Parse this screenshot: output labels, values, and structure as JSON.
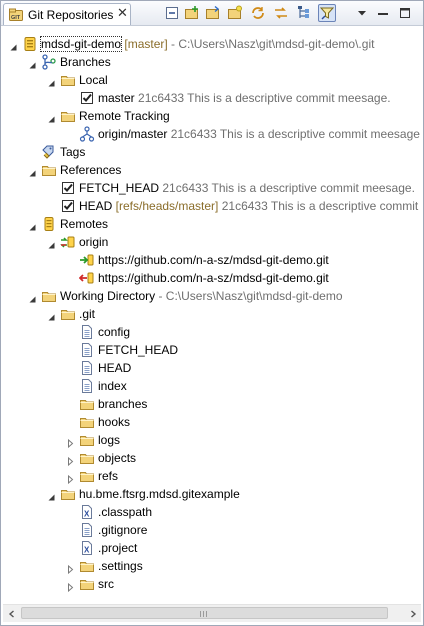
{
  "view": {
    "tab_title": "Git Repositories",
    "tab_icon": "git-repositories-icon",
    "close_glyph": "✕"
  },
  "toolbar": [
    {
      "name": "collapse-all-button",
      "icon": "collapse-all-icon"
    },
    {
      "name": "add-existing-repository-button",
      "icon": "add-repository-icon"
    },
    {
      "name": "clone-repository-button",
      "icon": "clone-repository-icon"
    },
    {
      "name": "create-repository-button",
      "icon": "create-repository-icon"
    },
    {
      "name": "refresh-button",
      "icon": "refresh-icon"
    },
    {
      "name": "link-with-selection-button",
      "icon": "link-with-selection-icon"
    },
    {
      "name": "hierarchical-branch-layout-button",
      "icon": "hierarchy-icon"
    },
    {
      "name": "show-tags-button",
      "icon": "filter-tags-icon",
      "active": true
    },
    {
      "name": "view-menu-button",
      "icon": "view-menu-triangle-icon"
    },
    {
      "name": "minimize-button",
      "icon": "minimize-icon"
    },
    {
      "name": "maximize-button",
      "icon": "maximize-icon"
    }
  ],
  "tree": [
    {
      "level": 0,
      "twisty": "expanded",
      "icon": "git-repository-icon",
      "parts": [
        {
          "t": "mdsd-git-demo",
          "c": "main"
        },
        {
          "t": " [master]",
          "c": "dec"
        },
        {
          "t": " - C:\\Users\\Nasz\\git\\mdsd-git-demo\\.git",
          "c": "grey"
        }
      ],
      "selected": true
    },
    {
      "level": 1,
      "twisty": "expanded",
      "icon": "branches-icon",
      "parts": [
        {
          "t": "Branches",
          "c": "main"
        }
      ]
    },
    {
      "level": 2,
      "twisty": "expanded",
      "icon": "folder-icon",
      "parts": [
        {
          "t": "Local",
          "c": "main"
        }
      ]
    },
    {
      "level": 3,
      "twisty": "none",
      "icon": "checked-out-branch-icon",
      "parts": [
        {
          "t": "master",
          "c": "main"
        },
        {
          "t": " 21c6433 This is a descriptive commit meesage.",
          "c": "grey"
        }
      ]
    },
    {
      "level": 2,
      "twisty": "expanded",
      "icon": "folder-icon",
      "parts": [
        {
          "t": "Remote Tracking",
          "c": "main"
        }
      ]
    },
    {
      "level": 3,
      "twisty": "none",
      "icon": "remote-branch-icon",
      "parts": [
        {
          "t": "origin/master",
          "c": "main"
        },
        {
          "t": " 21c6433 This is a descriptive commit meesage",
          "c": "grey"
        }
      ]
    },
    {
      "level": 1,
      "twisty": "none",
      "icon": "tags-icon",
      "parts": [
        {
          "t": "Tags",
          "c": "main"
        }
      ]
    },
    {
      "level": 1,
      "twisty": "expanded",
      "icon": "folder-icon",
      "parts": [
        {
          "t": "References",
          "c": "main"
        }
      ]
    },
    {
      "level": 2,
      "twisty": "none",
      "icon": "reference-icon",
      "parts": [
        {
          "t": "FETCH_HEAD",
          "c": "main"
        },
        {
          "t": " 21c6433 This is a descriptive commit meesage.",
          "c": "grey"
        }
      ]
    },
    {
      "level": 2,
      "twisty": "none",
      "icon": "reference-icon",
      "parts": [
        {
          "t": "HEAD",
          "c": "main"
        },
        {
          "t": " [refs/heads/master]",
          "c": "dec"
        },
        {
          "t": " 21c6433 This is a descriptive commit",
          "c": "grey"
        }
      ]
    },
    {
      "level": 1,
      "twisty": "expanded",
      "icon": "remotes-icon",
      "parts": [
        {
          "t": "Remotes",
          "c": "main"
        }
      ]
    },
    {
      "level": 2,
      "twisty": "expanded",
      "icon": "remote-icon",
      "parts": [
        {
          "t": "origin",
          "c": "main"
        }
      ]
    },
    {
      "level": 3,
      "twisty": "none",
      "icon": "fetch-url-icon",
      "parts": [
        {
          "t": "https://github.com/n-a-sz/mdsd-git-demo.git",
          "c": "main"
        }
      ]
    },
    {
      "level": 3,
      "twisty": "none",
      "icon": "push-url-icon",
      "parts": [
        {
          "t": "https://github.com/n-a-sz/mdsd-git-demo.git",
          "c": "main"
        }
      ]
    },
    {
      "level": 1,
      "twisty": "expanded",
      "icon": "folder-icon",
      "parts": [
        {
          "t": "Working Directory",
          "c": "main"
        },
        {
          "t": " - C:\\Users\\Nasz\\git\\mdsd-git-demo",
          "c": "grey"
        }
      ]
    },
    {
      "level": 2,
      "twisty": "expanded",
      "icon": "folder-icon",
      "parts": [
        {
          "t": ".git",
          "c": "main"
        }
      ]
    },
    {
      "level": 3,
      "twisty": "none",
      "icon": "file-icon",
      "parts": [
        {
          "t": "config",
          "c": "main"
        }
      ]
    },
    {
      "level": 3,
      "twisty": "none",
      "icon": "file-icon",
      "parts": [
        {
          "t": "FETCH_HEAD",
          "c": "main"
        }
      ]
    },
    {
      "level": 3,
      "twisty": "none",
      "icon": "file-icon",
      "parts": [
        {
          "t": "HEAD",
          "c": "main"
        }
      ]
    },
    {
      "level": 3,
      "twisty": "none",
      "icon": "file-icon",
      "parts": [
        {
          "t": "index",
          "c": "main"
        }
      ]
    },
    {
      "level": 3,
      "twisty": "none",
      "icon": "folder-icon",
      "parts": [
        {
          "t": "branches",
          "c": "main"
        }
      ]
    },
    {
      "level": 3,
      "twisty": "none",
      "icon": "folder-icon",
      "parts": [
        {
          "t": "hooks",
          "c": "main"
        }
      ]
    },
    {
      "level": 3,
      "twisty": "collapsed",
      "icon": "folder-icon",
      "parts": [
        {
          "t": "logs",
          "c": "main"
        }
      ]
    },
    {
      "level": 3,
      "twisty": "collapsed",
      "icon": "folder-icon",
      "parts": [
        {
          "t": "objects",
          "c": "main"
        }
      ]
    },
    {
      "level": 3,
      "twisty": "collapsed",
      "icon": "folder-icon",
      "parts": [
        {
          "t": "refs",
          "c": "main"
        }
      ]
    },
    {
      "level": 2,
      "twisty": "expanded",
      "icon": "folder-icon",
      "parts": [
        {
          "t": "hu.bme.ftsrg.mdsd.gitexample",
          "c": "main"
        }
      ]
    },
    {
      "level": 3,
      "twisty": "none",
      "icon": "xml-file-icon",
      "parts": [
        {
          "t": ".classpath",
          "c": "main"
        }
      ]
    },
    {
      "level": 3,
      "twisty": "none",
      "icon": "file-icon",
      "parts": [
        {
          "t": ".gitignore",
          "c": "main"
        }
      ]
    },
    {
      "level": 3,
      "twisty": "none",
      "icon": "xml-file-icon",
      "parts": [
        {
          "t": ".project",
          "c": "main"
        }
      ]
    },
    {
      "level": 3,
      "twisty": "collapsed",
      "icon": "folder-icon",
      "parts": [
        {
          "t": ".settings",
          "c": "main"
        }
      ]
    },
    {
      "level": 3,
      "twisty": "collapsed",
      "icon": "folder-icon",
      "parts": [
        {
          "t": "src",
          "c": "main"
        }
      ]
    }
  ],
  "colors": {
    "decoration": "#8a6d2a",
    "qualifier": "#6f6f6f",
    "folder": "#e8c060"
  }
}
